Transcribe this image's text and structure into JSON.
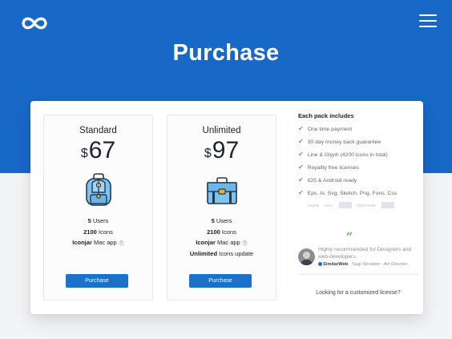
{
  "header": {
    "logo_icon": "infinity-logo-icon",
    "menu_icon": "hamburger-menu-icon",
    "title": "Purchase",
    "bg_color": "#1868c8"
  },
  "plans": [
    {
      "name": "Standard",
      "currency": "$",
      "price": "67",
      "icon": "backpack-icon",
      "users_count": "5",
      "users_label": "Users",
      "icons_count": "2100",
      "icons_label": "Icons",
      "app_name": "Iconjar",
      "app_label": "Mac app",
      "button_label": "Purchase"
    },
    {
      "name": "Unlimited",
      "currency": "$",
      "price": "97",
      "icon": "briefcase-icon",
      "users_count": "5",
      "users_label": "Users",
      "icons_count": "2100",
      "icons_label": "Icons",
      "app_name": "Iconjar",
      "app_label": "Mac app",
      "updates_name": "Unlimited",
      "updates_label": "Icons update",
      "button_label": "Purchase"
    }
  ],
  "includes": {
    "title": "Each pack includes",
    "items": [
      "One time payment",
      "30 day money back guarantee",
      "Line & Glyph (4200 icons in total)",
      "Royality free licenses",
      "iOS & Android ready",
      "Eps. Ai. Svg. Sketch. Png. Fons. Css"
    ],
    "payments": [
      "PayPal",
      "VISA",
      "",
      "DISCOVER",
      ""
    ]
  },
  "testimonial": {
    "quote_mark": "“",
    "text": "Highly recommended for Designers and web-developers.",
    "company": "SimilarWeb",
    "author": "Sagi Shrieber - Art Director"
  },
  "custom_license": "Looking for a customized license?",
  "colors": {
    "accent": "#1a72c9",
    "check": "#4ab84a"
  }
}
